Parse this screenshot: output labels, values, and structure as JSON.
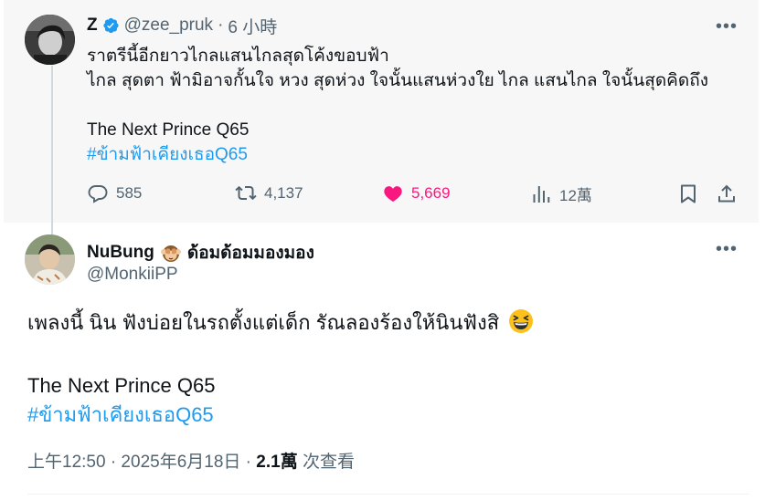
{
  "parent_tweet": {
    "name": "Z",
    "handle": "@zee_pruk",
    "separator": "·",
    "time": "6 小時",
    "more_label": "•••",
    "text_lines": [
      "ราตรีนี้อีกยาวไกลแสนไกลสุดโค้งขอบฟ้า",
      "ไกล สุดตา ฟ้ามิอาจกั้นใจ หวง สุดห่วง ใจนั้นแสนห่วงใย ไกล แสนไกล ใจนั้นสุดคิดถึง",
      "",
      "The Next Prince Q65"
    ],
    "hashtag": "#ข้ามฟ้าเคียงเธอQ65",
    "stats": {
      "replies": "585",
      "retweets": "4,137",
      "likes": "5,669",
      "views": "12萬"
    },
    "colors": {
      "like": "#f91880",
      "link": "#1d9bf0",
      "verified": "#1d9bf0"
    }
  },
  "reply_tweet": {
    "name": "NuBung",
    "name_suffix": "ด้อมด้อมมองมอง",
    "name_emoji": "see-no-evil-monkey",
    "handle": "@MonkiiPP",
    "more_label": "•••",
    "text_line1": "เพลงนี้ นิน ฟังบ่อยในรถตั้งแต่เด็ก รัณลองร้องให้นินฟังสิ",
    "text_emoji": "grinning-squinting-face",
    "text_line2": "The Next Prince Q65",
    "hashtag": "#ข้ามฟ้าเคียงเธอQ65",
    "timestamp": "上午12:50 · 2025年6月18日 · ",
    "views_count": "2.1萬",
    "views_label": " 次查看"
  }
}
